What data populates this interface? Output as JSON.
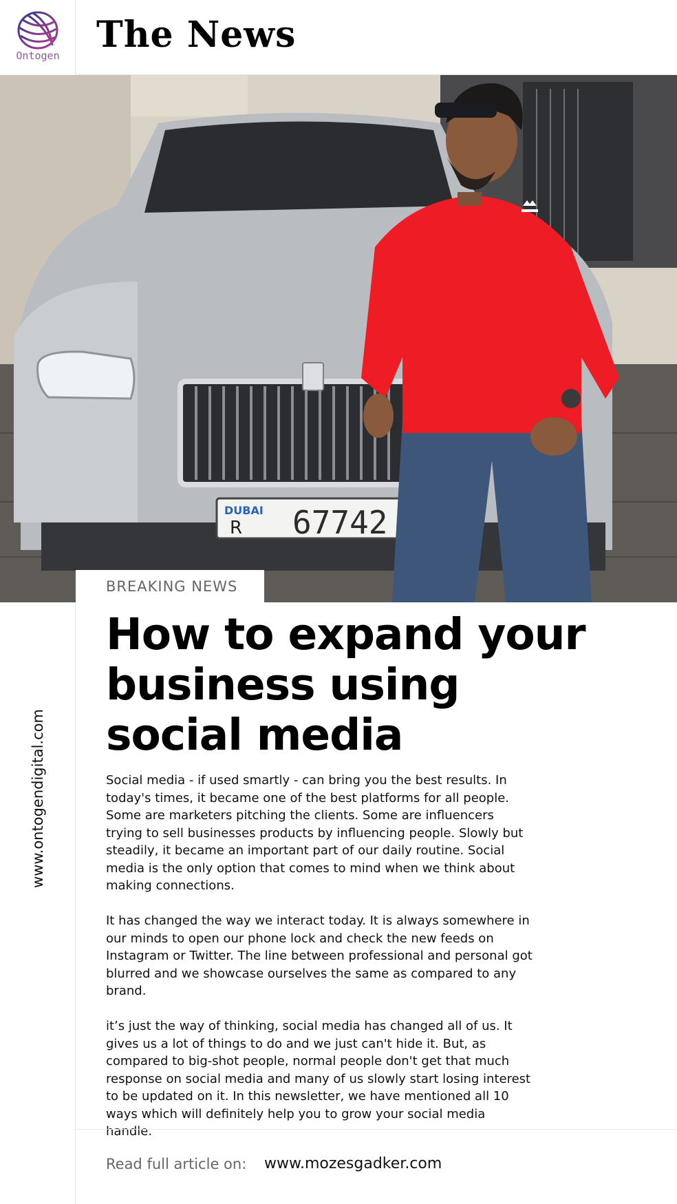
{
  "brand": {
    "logo_text": "Ontogen",
    "masthead": "The News",
    "vertical_url": "www.ontogendigital.com"
  },
  "hero": {
    "plate_emirate": "DUBAI",
    "plate_letter": "R",
    "plate_number": "67742"
  },
  "article": {
    "tag": "BREAKING NEWS",
    "headline": "How to expand your business using social media",
    "paragraphs": [
      "Social media - if used smartly - can bring you the best results. In today's times, it became one of the best platforms for all people. Some are marketers pitching the clients. Some are influencers trying to sell businesses products by influencing people. Slowly but steadily, it became an important part of our daily routine. Social media is the only option that comes to mind when we think about making connections.",
      "It has changed the way we interact today. It is always somewhere in our minds to open our phone lock and check the new feeds on Instagram or Twitter. The line between professional and personal got blurred and we showcase ourselves the same as compared to any brand.",
      "it’s just the way of thinking, social media has changed all of us. It gives us a lot of things to do and we just can't hide it. But, as compared to big-shot people, normal people don't get that much response on social media and many of us slowly start losing interest to be updated on it. In this newsletter, we have mentioned all 10 ways which will definitely help you to grow your social media handle."
    ]
  },
  "footer": {
    "label": "Read full article on:",
    "link": "www.mozesgadker.com"
  },
  "colors": {
    "accent_red": "#ee1c25",
    "car_silver": "#b9bcc0",
    "text_gray": "#666666"
  }
}
